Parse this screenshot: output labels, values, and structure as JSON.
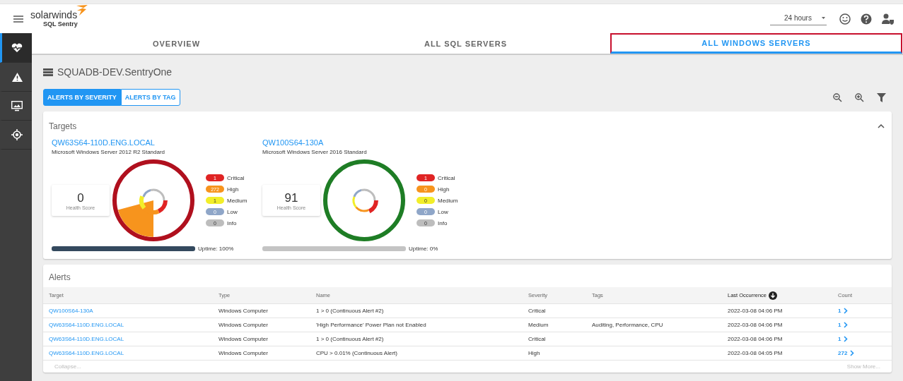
{
  "header": {
    "logo_name": "solarwinds",
    "logo_product": "SQL Sentry",
    "time_range": "24 hours"
  },
  "sidebar": {
    "items": [
      {
        "selected": true
      },
      {
        "selected": false
      },
      {
        "selected": false
      },
      {
        "selected": false
      }
    ]
  },
  "tabs": [
    {
      "label": "OVERVIEW",
      "selected": false
    },
    {
      "label": "ALL SQL SERVERS",
      "selected": false
    },
    {
      "label": "ALL WINDOWS SERVERS",
      "selected": true
    }
  ],
  "title": "SQUADB-DEV.SentryOne",
  "view_toggle": [
    {
      "label": "ALERTS BY SEVERITY",
      "selected": true
    },
    {
      "label": "ALERTS BY TAG",
      "selected": false
    }
  ],
  "targets_panel": {
    "title": "Targets",
    "expanded": true,
    "targets": [
      {
        "name": "QW63S64-110D.ENG.LOCAL",
        "os": "Microsoft Windows Server 2012 R2 Standard",
        "health_score": "0",
        "health_label": "Health Score",
        "color": "#b0101e",
        "uptime": "Uptime: 100%",
        "level": 1,
        "severities": [
          {
            "count": "1",
            "label": "Critical",
            "color": "#e02424"
          },
          {
            "count": "272",
            "label": "High",
            "color": "#f7941d"
          },
          {
            "count": "1",
            "label": "Medium",
            "color": "#f2ee2a"
          },
          {
            "count": "0",
            "label": "Low",
            "color": "#8fa6c8"
          },
          {
            "count": "0",
            "label": "Info",
            "color": "#bdbdbd"
          }
        ]
      },
      {
        "name": "QW100S64-130A",
        "os": "Microsoft Windows Server 2016 Standard",
        "health_score": "91",
        "health_label": "Health Score",
        "color": "#1e7d25",
        "uptime": "Uptime: 0%",
        "level": 0,
        "severities": [
          {
            "count": "1",
            "label": "Critical",
            "color": "#e02424"
          },
          {
            "count": "0",
            "label": "High",
            "color": "#f7941d"
          },
          {
            "count": "0",
            "label": "Medium",
            "color": "#f2ee2a"
          },
          {
            "count": "0",
            "label": "Low",
            "color": "#8fa6c8"
          },
          {
            "count": "0",
            "label": "Info",
            "color": "#bdbdbd"
          }
        ]
      }
    ]
  },
  "alerts": {
    "title": "Alerts",
    "columns": [
      "Target",
      "Type",
      "Name",
      "Severity",
      "Tags",
      "Last Occurrence",
      "Count"
    ],
    "rows": [
      {
        "target": "QW100S64-130A",
        "type": "Windows Computer",
        "name": "1 > 0 (Continuous Alert #2)",
        "severity": "Critical",
        "tags": "",
        "last": "2022-03-08 04:06 PM",
        "count": "1"
      },
      {
        "target": "QW63S64-110D.ENG.LOCAL",
        "type": "Windows Computer",
        "name": "'High Performance' Power Plan not Enabled",
        "severity": "Medium",
        "tags": "Auditing, Performance, CPU",
        "last": "2022-03-08 04:06 PM",
        "count": "1"
      },
      {
        "target": "QW63S64-110D.ENG.LOCAL",
        "type": "Windows Computer",
        "name": "1 > 0 (Continuous Alert #2)",
        "severity": "Critical",
        "tags": "",
        "last": "2022-03-08 04:06 PM",
        "count": "1"
      },
      {
        "target": "QW63S64-110D.ENG.LOCAL",
        "type": "Windows Computer",
        "name": "CPU > 0.01% (Continuous Alert)",
        "severity": "High",
        "tags": "",
        "last": "2022-03-08 04:05 PM",
        "count": "272"
      }
    ],
    "collapse": "Collapse...",
    "show_more": "Show More..."
  }
}
